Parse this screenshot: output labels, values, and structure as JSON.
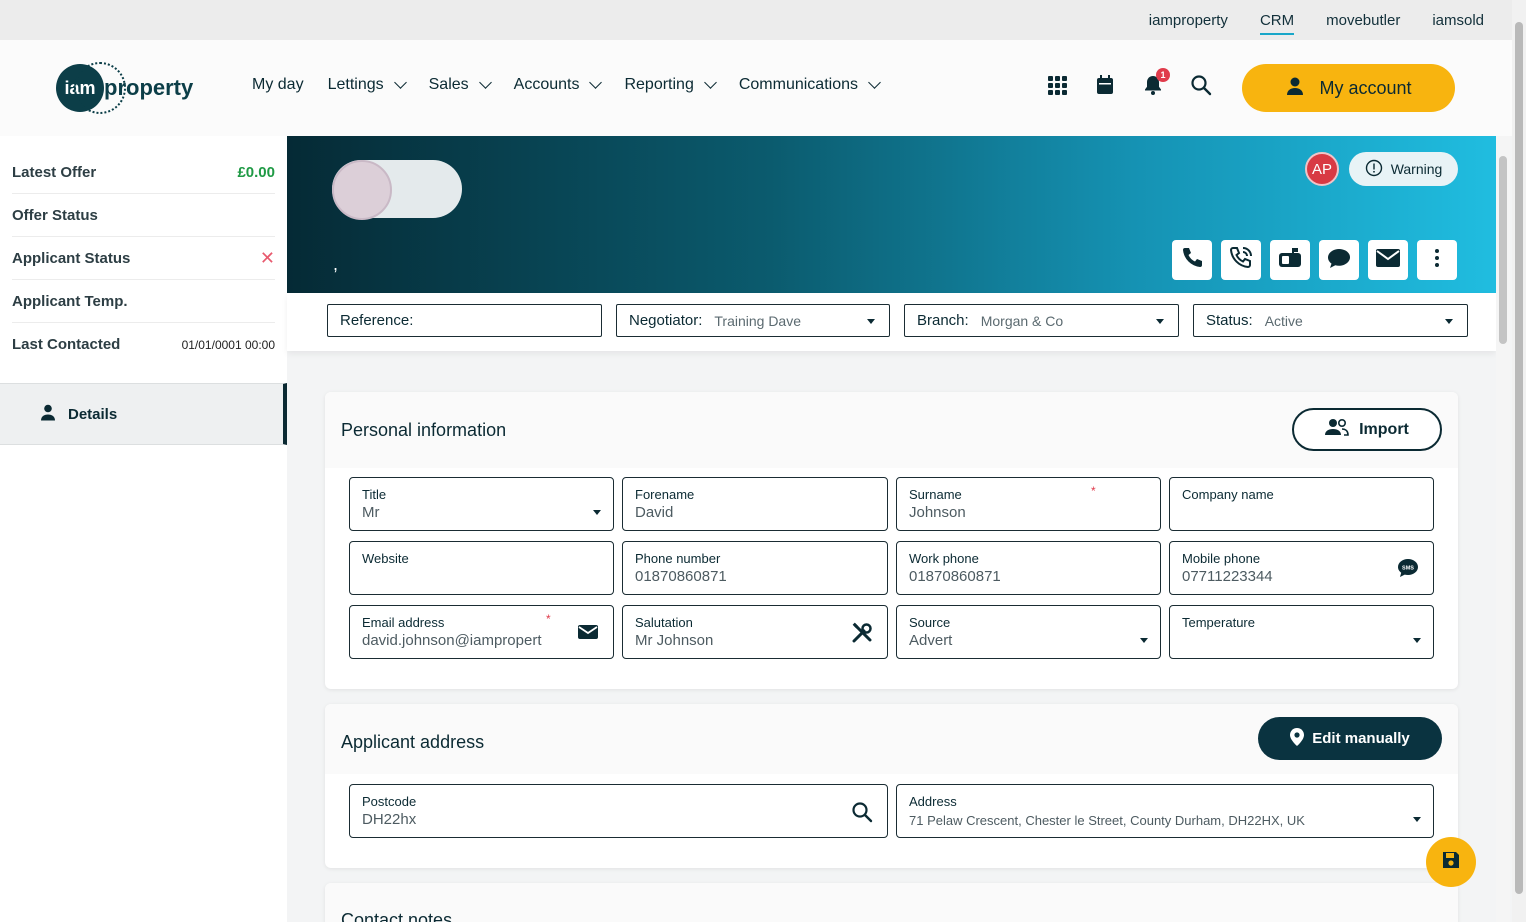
{
  "top_links": [
    {
      "label": "iamproperty",
      "active": false
    },
    {
      "label": "CRM",
      "active": true
    },
    {
      "label": "movebutler",
      "active": false
    },
    {
      "label": "iamsold",
      "active": false
    }
  ],
  "logo": {
    "mark": "iam",
    "word": "property"
  },
  "nav": {
    "my_day": "My day",
    "lettings": "Lettings",
    "sales": "Sales",
    "accounts": "Accounts",
    "reporting": "Reporting",
    "communications": "Communications"
  },
  "header": {
    "notification_count": "1",
    "account_label": "My account"
  },
  "sidebar": {
    "latest_offer_label": "Latest Offer",
    "latest_offer_value": "£0.00",
    "offer_status_label": "Offer Status",
    "applicant_status_label": "Applicant Status",
    "applicant_status_value": "✕",
    "applicant_temp_label": "Applicant Temp.",
    "last_contacted_label": "Last Contacted",
    "last_contacted_value": "01/01/0001 00:00",
    "details_tab": "Details"
  },
  "hero": {
    "name_line": ",",
    "initials": "AP",
    "warning_label": "Warning"
  },
  "filters": {
    "reference_label": "Reference:",
    "reference_value": "",
    "negotiator_label": "Negotiator:",
    "negotiator_value": "Training Dave",
    "branch_label": "Branch:",
    "branch_value": "Morgan & Co",
    "status_label": "Status:",
    "status_value": "Active"
  },
  "personal": {
    "title": "Personal information",
    "import_label": "Import",
    "fields": {
      "title_label": "Title",
      "title_value": "Mr",
      "forename_label": "Forename",
      "forename_value": "David",
      "surname_label": "Surname",
      "surname_value": "Johnson",
      "company_label": "Company name",
      "company_value": "",
      "website_label": "Website",
      "website_value": "",
      "phone_label": "Phone number",
      "phone_value": "01870860871",
      "work_label": "Work phone",
      "work_value": "01870860871",
      "mobile_label": "Mobile phone",
      "mobile_value": "07711223344",
      "email_label": "Email address",
      "email_value": "david.johnson@iampropert",
      "salutation_label": "Salutation",
      "salutation_value": "Mr Johnson",
      "source_label": "Source",
      "source_value": "Advert",
      "temperature_label": "Temperature",
      "temperature_value": ""
    }
  },
  "address": {
    "title": "Applicant address",
    "edit_label": "Edit manually",
    "postcode_label": "Postcode",
    "postcode_value": "DH22hx",
    "address_label": "Address",
    "address_value": "71 Pelaw Crescent, Chester le Street, County Durham, DH22HX, UK"
  },
  "notes": {
    "title": "Contact notes"
  },
  "colors": {
    "accent": "#f8b40f",
    "dark": "#0a3340",
    "cyan": "#20bde0"
  }
}
